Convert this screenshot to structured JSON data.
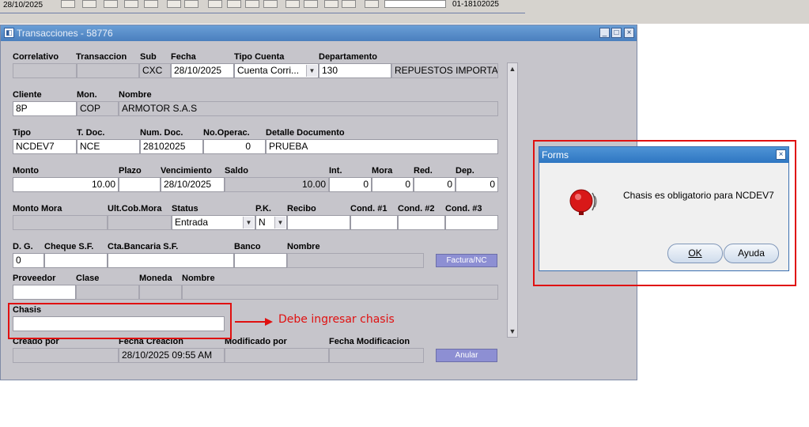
{
  "toolbar": {
    "date": "28/10/2025",
    "doc_ref": "01-18102025"
  },
  "window": {
    "title": "Transacciones - 58776"
  },
  "header": {
    "labels": {
      "correlativo": "Correlativo",
      "transaccion": "Transaccion",
      "sub": "Sub",
      "fecha": "Fecha",
      "tipo_cuenta": "Tipo Cuenta",
      "departamento": "Departamento"
    },
    "values": {
      "correlativo": "",
      "transaccion": "",
      "sub": "CXC",
      "fecha": "28/10/2025",
      "tipo_cuenta": "Cuenta Corri...",
      "departamento": "130",
      "departamento_nombre": "REPUESTOS IMPORTA"
    }
  },
  "cliente": {
    "labels": {
      "cliente": "Cliente",
      "moneda": "Mon.",
      "nombre": "Nombre"
    },
    "values": {
      "cliente": "8P",
      "moneda": "COP",
      "nombre": "ARMOTOR S.A.S"
    }
  },
  "documento": {
    "labels": {
      "tipo": "Tipo",
      "tdoc": "T. Doc.",
      "numdoc": "Num. Doc.",
      "nooperac": "No.Operac.",
      "detalle": "Detalle Documento"
    },
    "values": {
      "tipo": "NCDEV7",
      "tdoc": "NCE",
      "numdoc": "28102025",
      "nooperac": "0",
      "detalle": "PRUEBA"
    }
  },
  "montos": {
    "labels": {
      "monto": "Monto",
      "plazo": "Plazo",
      "vencimiento": "Vencimiento",
      "saldo": "Saldo",
      "int": "Int.",
      "mora": "Mora",
      "red": "Red.",
      "dep": "Dep."
    },
    "values": {
      "monto": "10.00",
      "plazo": "",
      "vencimiento": "28/10/2025",
      "saldo": "10.00",
      "int": "0",
      "mora": "0",
      "red": "0",
      "dep": "0"
    }
  },
  "estado": {
    "labels": {
      "monto_mora": "Monto Mora",
      "ult_cob_mora": "Ult.Cob.Mora",
      "status": "Status",
      "pk": "P.K.",
      "recibo": "Recibo",
      "cond1": "Cond. #1",
      "cond2": "Cond. #2",
      "cond3": "Cond. #3"
    },
    "values": {
      "status": "Entrada",
      "pk": "N"
    }
  },
  "banco": {
    "labels": {
      "dg": "D. G.",
      "cheque_sf": "Cheque S.F.",
      "cta_bancaria_sf": "Cta.Bancaria S.F.",
      "banco": "Banco",
      "nombre": "Nombre"
    },
    "values": {
      "dg": "0"
    },
    "factura_button": "Factura/NC"
  },
  "proveedor": {
    "labels": {
      "proveedor": "Proveedor",
      "clase": "Clase",
      "moneda": "Moneda",
      "nombre": "Nombre"
    }
  },
  "chasis": {
    "label": "Chasis",
    "value": ""
  },
  "annotation": "Debe ingresar chasis",
  "auditoria": {
    "labels": {
      "creado_por": "Creado por",
      "fecha_creacion": "Fecha Creacion",
      "modificado_por": "Modificado por",
      "fecha_modificacion": "Fecha Modificacion"
    },
    "values": {
      "fecha_creacion": "28/10/2025 09:55 AM"
    },
    "anular_button": "Anular"
  },
  "dialog": {
    "title": "Forms",
    "message": "Chasis es obligatorio para NCDEV7",
    "ok_button": "OK",
    "help_button": "Ayuda",
    "icon": "alarm-bell-icon"
  },
  "colors": {
    "highlight": "#e01010",
    "window_bg": "#c6c5cb",
    "button_blue": "#8d8fd3"
  }
}
